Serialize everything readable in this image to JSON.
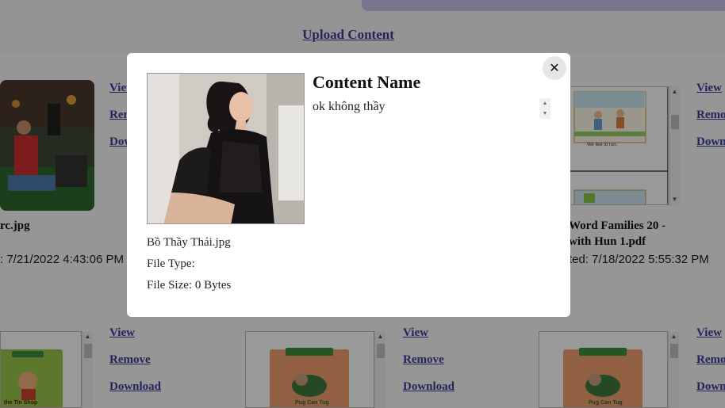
{
  "page": {
    "upload_link": "Upload Content"
  },
  "cards": {
    "top_left": {
      "title": "rc.jpg",
      "date": ": 7/21/2022 4:43:06 PM",
      "view": "View",
      "remove": "Rem",
      "download": "Dow"
    },
    "top_right": {
      "title_line1": "Word Families 20 -",
      "title_line2": "with Hun 1.pdf",
      "date": "ted: 7/18/2022 5:55:32 PM",
      "view": "View",
      "remove": "Remo",
      "download": "Down",
      "thumb_caption": "We like to run."
    },
    "bottom_1": {
      "view": "View",
      "remove": "Remove",
      "download": "Download",
      "thumb_caption": "the Tin Shop"
    },
    "bottom_2": {
      "view": "View",
      "remove": "Remove",
      "download": "Download",
      "thumb_caption": "Pug Can Tug"
    },
    "bottom_3": {
      "view": "View",
      "remove": "Remo",
      "download": "Down",
      "thumb_caption": "Pug Can Tug"
    }
  },
  "modal": {
    "heading": "Content Name",
    "description": "ok không thầy",
    "file_name": "Bồ Thầy Thái.jpg",
    "file_type_label": "File Type:",
    "file_size_label": "File Size: 0 Bytes",
    "close_icon": "close-icon"
  },
  "colors": {
    "link": "#3c3c9a",
    "overlay": "rgba(0,0,0,0.4)",
    "accent_strip": "#c9c4ee"
  }
}
